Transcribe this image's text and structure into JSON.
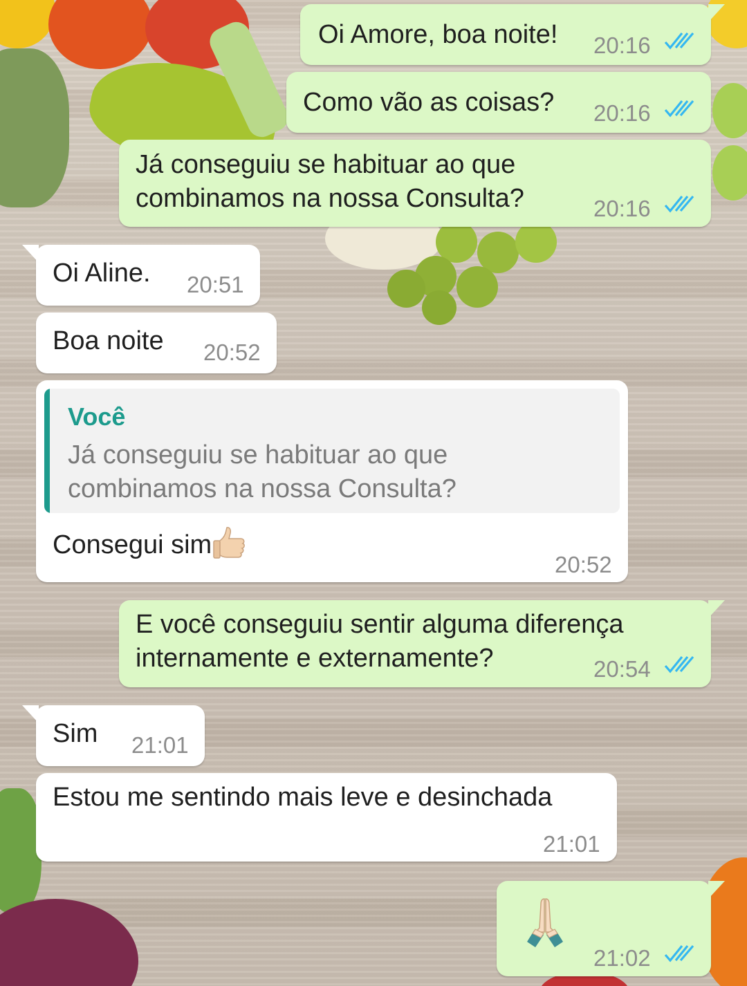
{
  "colors": {
    "outgoing_bubble": "#dcf8c6",
    "incoming_bubble": "#ffffff",
    "read_ticks": "#34b7f1",
    "quote_accent": "#1d9b8d",
    "timestamp": "#8c8c8c"
  },
  "messages": [
    {
      "direction": "outgoing",
      "text": "Oi Amore, boa noite!",
      "time": "20:16",
      "status": "read"
    },
    {
      "direction": "outgoing",
      "text": "Como vão as coisas?",
      "time": "20:16",
      "status": "read"
    },
    {
      "direction": "outgoing",
      "text": "Já conseguiu se habituar ao que\ncombinamos na nossa Consulta?",
      "time": "20:16",
      "status": "read"
    },
    {
      "direction": "incoming",
      "text": "Oi Aline.",
      "time": "20:51"
    },
    {
      "direction": "incoming",
      "text": "Boa noite",
      "time": "20:52"
    },
    {
      "direction": "incoming",
      "quote": {
        "author": "Você",
        "text": "Já conseguiu se habituar ao que\ncombinamos na nossa Consulta?"
      },
      "text": "Consegui sim",
      "emoji": "thumbs-up-icon",
      "time": "20:52"
    },
    {
      "direction": "outgoing",
      "text": "E você conseguiu sentir alguma diferença\ninternamente e externamente?",
      "time": "20:54",
      "status": "read"
    },
    {
      "direction": "incoming",
      "text": "Sim",
      "time": "21:01"
    },
    {
      "direction": "incoming",
      "text": "Estou me sentindo mais leve e desinchada",
      "time": "21:01"
    },
    {
      "direction": "outgoing",
      "text": "",
      "emoji": "folded-hands-icon",
      "time": "21:02",
      "status": "read"
    }
  ]
}
